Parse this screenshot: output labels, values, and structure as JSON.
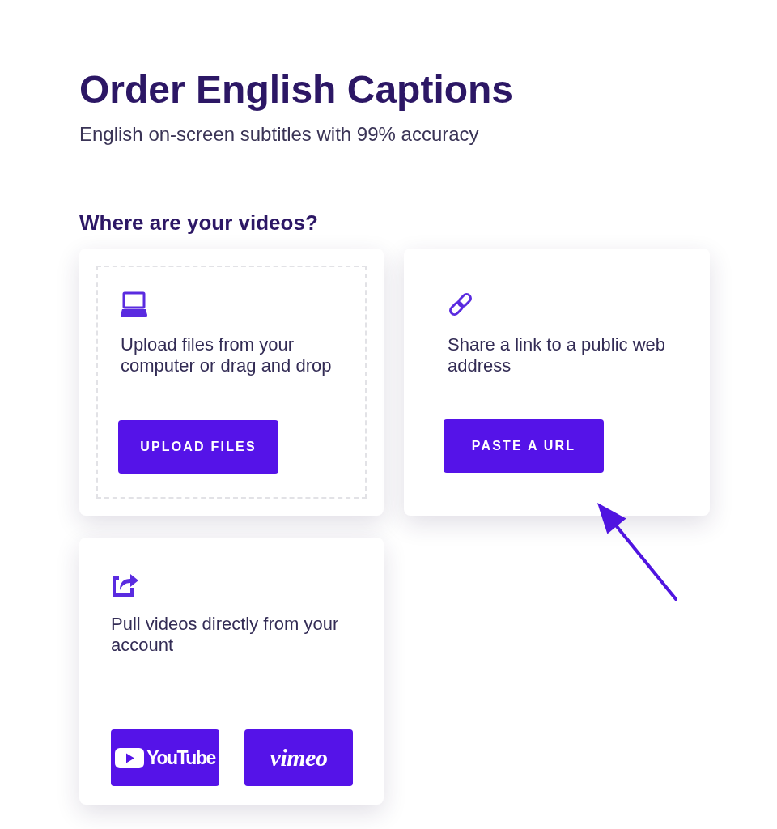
{
  "page": {
    "title": "Order English Captions",
    "subtitle": "English on-screen subtitles with 99% accuracy"
  },
  "section": {
    "heading": "Where are your videos?"
  },
  "cards": [
    {
      "kind": "upload",
      "description": "Upload files from your computer or drag and drop",
      "buttons": [
        {
          "kind": "text",
          "label": "UPLOAD FILES"
        }
      ]
    },
    {
      "kind": "link",
      "description": "Share a link to a public web address",
      "buttons": [
        {
          "kind": "text",
          "label": "PASTE A URL"
        }
      ]
    },
    {
      "kind": "account",
      "description": "Pull videos directly from your account",
      "buttons": [
        {
          "kind": "youtube",
          "label": "YouTube"
        },
        {
          "kind": "vimeo",
          "label": "vimeo"
        }
      ]
    }
  ]
}
